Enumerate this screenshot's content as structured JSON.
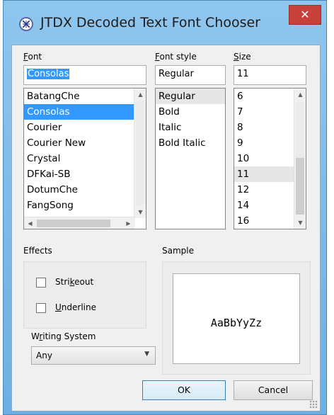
{
  "window": {
    "title": "JTDX Decoded Text Font Chooser",
    "close_glyph": "✕",
    "app_icon": "compass-icon"
  },
  "font": {
    "label": "Font",
    "value": "Consolas",
    "items": [
      "BatangChe",
      "Consolas",
      "Courier",
      "Courier New",
      "Crystal",
      "DFKai-SB",
      "DotumChe",
      "FangSong"
    ],
    "selected": "Consolas"
  },
  "font_style": {
    "label": "Font style",
    "value": "Regular",
    "items": [
      "Regular",
      "Bold",
      "Italic",
      "Bold Italic"
    ],
    "selected": "Regular"
  },
  "size": {
    "label": "Size",
    "value": "11",
    "items": [
      "6",
      "7",
      "8",
      "9",
      "10",
      "11",
      "12",
      "14",
      "16"
    ],
    "selected": "11"
  },
  "effects": {
    "label": "Effects",
    "strikeout": {
      "label": "Strikeout",
      "checked": false
    },
    "underline": {
      "label": "Underline",
      "checked": false
    }
  },
  "sample": {
    "label": "Sample",
    "text": "AaBbYyZz"
  },
  "writing_system": {
    "label": "Writing System",
    "value": "Any"
  },
  "buttons": {
    "ok": "OK",
    "cancel": "Cancel"
  },
  "colors": {
    "selection": "#3399ff",
    "close_button": "#c7403a",
    "titlebar": "#8fc6ee"
  }
}
